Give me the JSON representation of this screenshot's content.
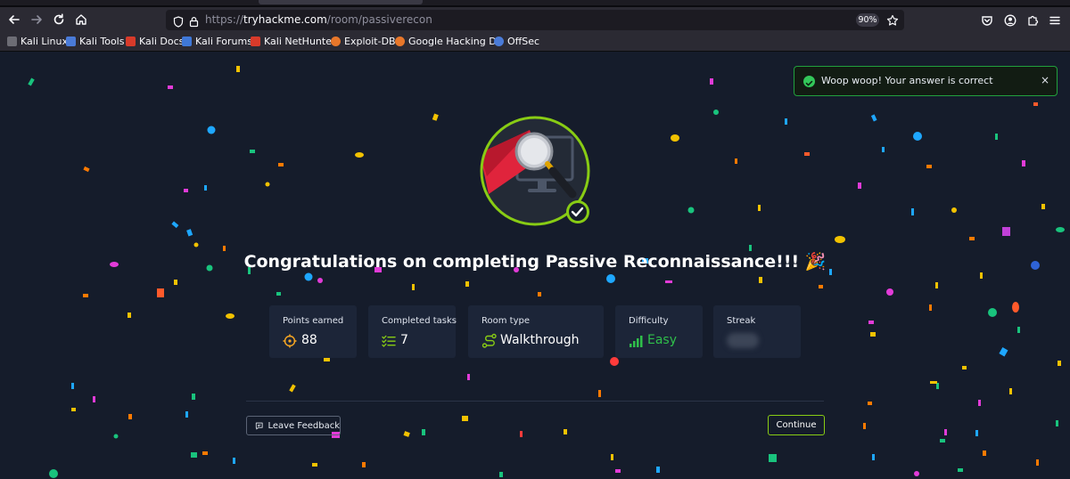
{
  "browser": {
    "url_scheme": "https://",
    "url_host": "tryhackme.com",
    "url_path": "/room/passiverecon",
    "zoom": "90%",
    "bookmarks": [
      {
        "label": "Kali Linux",
        "icon": "kali-dragon-icon",
        "color": "#e0e0e0"
      },
      {
        "label": "Kali Tools",
        "icon": "kali-tools-icon",
        "color": "#4a7bd8"
      },
      {
        "label": "Kali Docs",
        "icon": "kali-docs-icon",
        "color": "#d83a2a"
      },
      {
        "label": "Kali Forums",
        "icon": "kali-forums-icon",
        "color": "#3f78d8"
      },
      {
        "label": "Kali NetHunter",
        "icon": "nethunter-icon",
        "color": "#d83a2a"
      },
      {
        "label": "Exploit-DB",
        "icon": "exploit-db-icon",
        "color": "#e8772a"
      },
      {
        "label": "Google Hacking DB",
        "icon": "ghdb-icon",
        "color": "#e8772a"
      },
      {
        "label": "OffSec",
        "icon": "offsec-icon",
        "color": "#4a7bd8"
      }
    ]
  },
  "toast": {
    "message": "Woop woop! Your answer is correct",
    "close": "×",
    "color": "#21a03d"
  },
  "main": {
    "title": "Congratulations on completing Passive Reconnaissance!!! 🎉",
    "accent": "#88cc14",
    "stats": [
      {
        "label": "Points earned",
        "value": "88",
        "icon": "target-icon"
      },
      {
        "label": "Completed tasks",
        "value": "7",
        "icon": "checklist-icon"
      },
      {
        "label": "Room type",
        "value": "Walkthrough",
        "icon": "route-icon"
      },
      {
        "label": "Difficulty",
        "value": "Easy",
        "icon": "signal-bars-icon",
        "color": "#2fbf4a"
      },
      {
        "label": "Streak",
        "value": "",
        "icon": "streak-icon"
      }
    ],
    "feedback_label": "Leave Feedback",
    "continue_label": "Continue"
  }
}
